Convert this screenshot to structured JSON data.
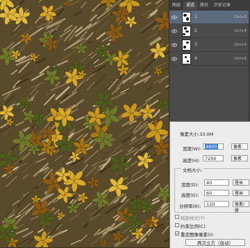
{
  "panel": {
    "tabs": [
      "图层",
      "通道",
      "路径",
      "历史记录"
    ],
    "active_tab": 1,
    "channels": [
      {
        "name": "1",
        "shortcut": "Ctrl+3",
        "selected": true
      },
      {
        "name": "2",
        "shortcut": "Ctrl+4",
        "selected": false
      },
      {
        "name": "3",
        "shortcut": "Ctrl+5",
        "selected": false
      },
      {
        "name": "4",
        "shortcut": "Ctrl+6",
        "selected": false
      }
    ]
  },
  "dialog": {
    "pixel_size": "像素大小:33.0M",
    "width_label": "宽度(W):",
    "width_value": "4800",
    "width_unit": "像素",
    "height_label": "高度(H):",
    "height_value": "7200",
    "height_unit": "像素",
    "doc_size_label": "文档大小:",
    "doc_width_label": "宽度(D):",
    "doc_width_value": "40",
    "doc_width_unit": "厘米",
    "doc_height_label": "高度(G):",
    "doc_height_value": "60",
    "doc_height_unit": "厘米",
    "resolution_label": "分辨率(R):",
    "resolution_value": "120",
    "resolution_unit": "像素/厘",
    "scale_styles": "缩放样式(Y)",
    "constrain": "约束比例(C)",
    "resample": "重定图像像素(I):",
    "method": "两次立方（自动）"
  },
  "colors": {
    "panel_bg": "#4b4b4b",
    "selected_row": "#5c6a7d",
    "dialog_bg": "#ececec",
    "highlight": "#3b7fd6"
  }
}
